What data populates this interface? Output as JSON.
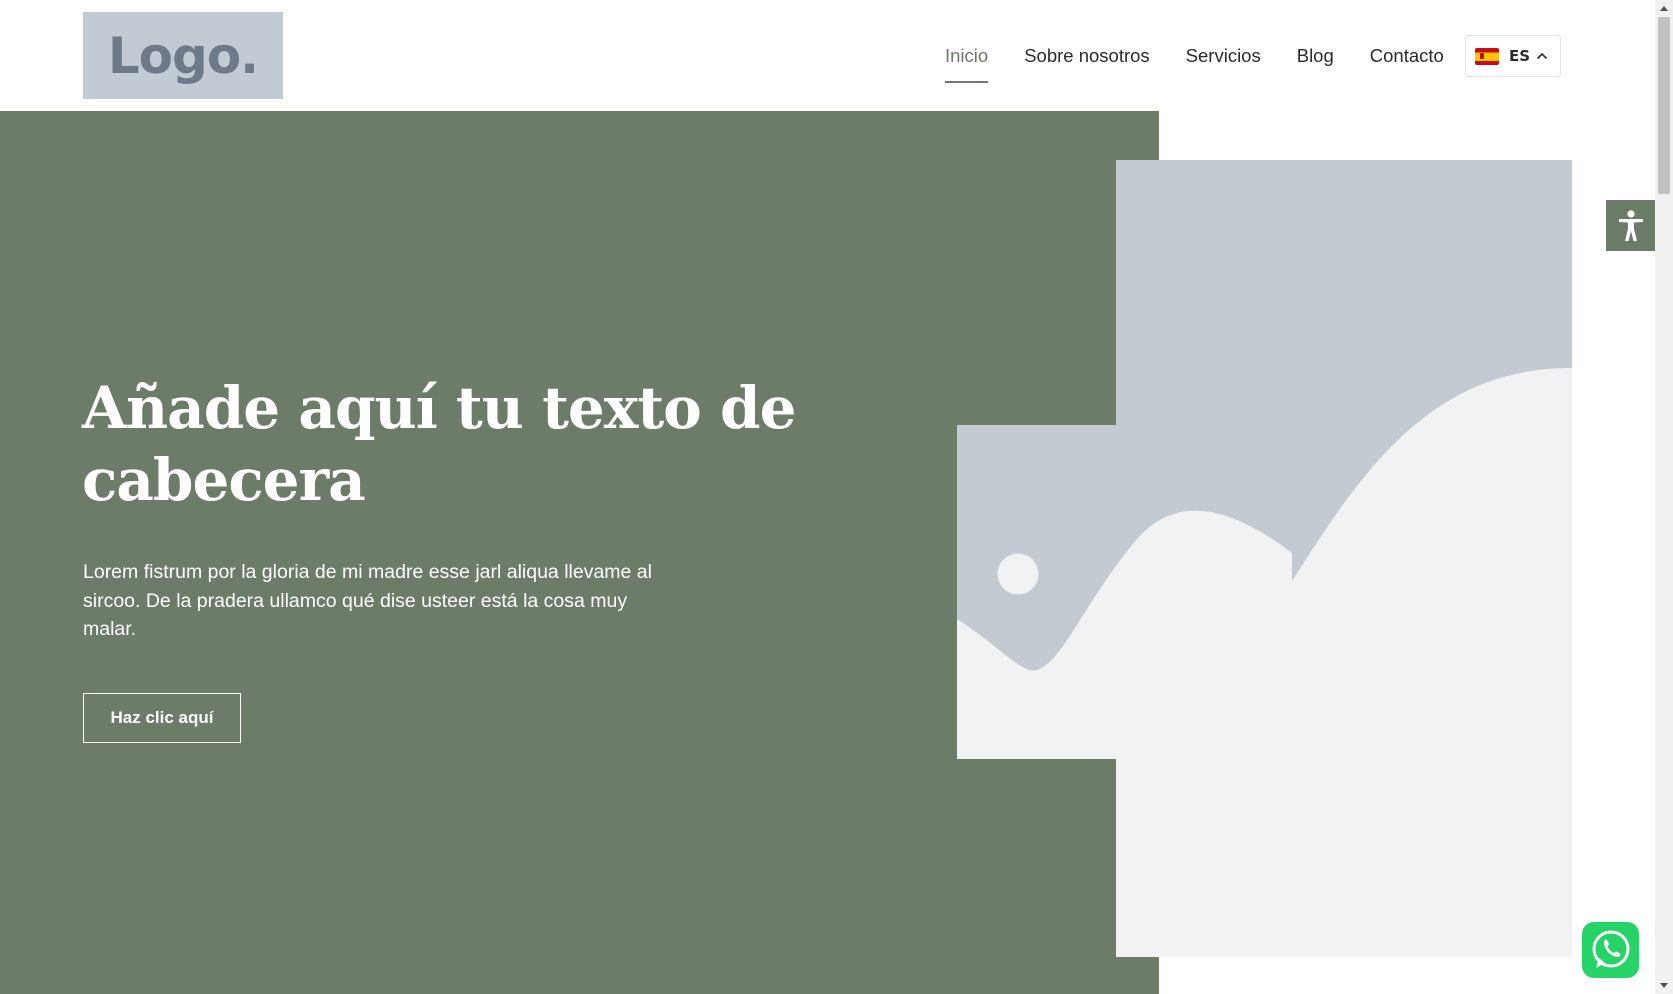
{
  "header": {
    "logo_text": "Logo.",
    "nav": [
      "Inicio",
      "Sobre nosotros",
      "Servicios",
      "Blog",
      "Contacto"
    ],
    "active_nav": "Inicio",
    "language": {
      "code": "ES",
      "flag_icon": "spain-flag-icon"
    }
  },
  "hero": {
    "title": "Añade aquí tu texto de cabecera",
    "text": "Lorem fistrum por la gloria de mi madre esse jarl aliqua llevame al sircoo. De la pradera ullamco qué dise usteer está la cosa muy malar.",
    "button_label": "Haz clic aquí",
    "image_icon": "image-placeholder-icon"
  },
  "widgets": {
    "accessibility_icon": "accessibility-icon",
    "whatsapp_icon": "whatsapp-icon"
  },
  "colors": {
    "hero_bg": "#6d7c69",
    "logo_bg": "#c2cad4",
    "placeholder_dark": "#c3cad2",
    "placeholder_light": "#f1f2f4",
    "whatsapp": "#25d366"
  }
}
